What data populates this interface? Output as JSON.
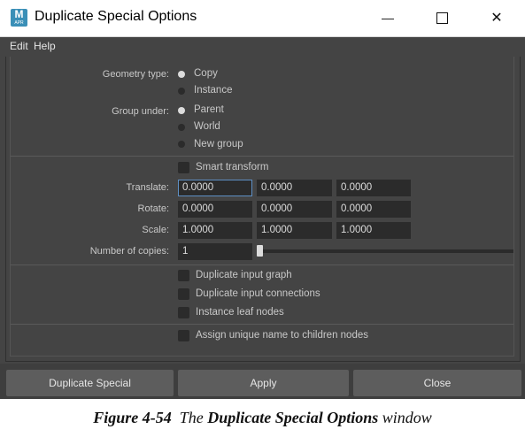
{
  "window": {
    "app_icon_letter": "M",
    "app_icon_sub": "APR",
    "title": "Duplicate Special Options",
    "min_glyph": "—",
    "max_glyph": "☐",
    "close_glyph": "✕"
  },
  "menu": {
    "edit": "Edit",
    "help": "Help"
  },
  "geometry": {
    "label": "Geometry type:",
    "options": [
      "Copy",
      "Instance"
    ],
    "selected": "Copy"
  },
  "group": {
    "label": "Group under:",
    "options": [
      "Parent",
      "World",
      "New group"
    ],
    "selected": "Parent"
  },
  "smart_transform": {
    "label": "Smart transform",
    "checked": false
  },
  "translate": {
    "label": "Translate:",
    "values": [
      "0.0000",
      "0.0000",
      "0.0000"
    ]
  },
  "rotate": {
    "label": "Rotate:",
    "values": [
      "0.0000",
      "0.0000",
      "0.0000"
    ]
  },
  "scale": {
    "label": "Scale:",
    "values": [
      "1.0000",
      "1.0000",
      "1.0000"
    ]
  },
  "copies": {
    "label": "Number of copies:",
    "value": "1"
  },
  "checks": {
    "input_graph": "Duplicate input graph",
    "input_connections": "Duplicate input connections",
    "instance_leaf": "Instance leaf nodes",
    "unique_name": "Assign unique name to children nodes"
  },
  "buttons": {
    "duplicate_special": "Duplicate Special",
    "apply": "Apply",
    "close": "Close"
  },
  "caption": {
    "figure": "Figure 4-54",
    "the": "The",
    "name": "Duplicate Special Options",
    "window": "window"
  }
}
